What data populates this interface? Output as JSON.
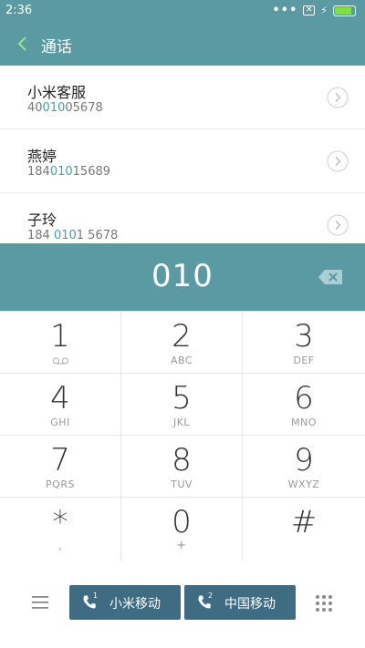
{
  "status_bar": {
    "time": "2:36",
    "dots": "•••",
    "sim_text": "✕",
    "battery_level": 0.85,
    "battery_color": "#7ee23a"
  },
  "app_bar": {
    "title": "通话",
    "color": "#5a9aa3"
  },
  "contacts": [
    {
      "name": "小米客服",
      "number_pre": "40",
      "number_match": "010",
      "number_post": "05678"
    },
    {
      "name": "燕婷",
      "number_pre": "184",
      "number_match": "010",
      "number_post": "15689"
    },
    {
      "name": "子玲",
      "number_pre": "184 ",
      "number_match": "010",
      "number_post": "1 5678"
    }
  ],
  "dialer": {
    "input": "010"
  },
  "keypad": [
    {
      "digit": "1",
      "letters": ""
    },
    {
      "digit": "2",
      "letters": "ABC"
    },
    {
      "digit": "3",
      "letters": "DEF"
    },
    {
      "digit": "4",
      "letters": "GHI"
    },
    {
      "digit": "5",
      "letters": "JKL"
    },
    {
      "digit": "6",
      "letters": "MNO"
    },
    {
      "digit": "7",
      "letters": "PQRS"
    },
    {
      "digit": "8",
      "letters": "TUV"
    },
    {
      "digit": "9",
      "letters": "WXYZ"
    },
    {
      "digit": "*",
      "letters": ","
    },
    {
      "digit": "0",
      "letters": "+"
    },
    {
      "digit": "#",
      "letters": ""
    }
  ],
  "bottom_bar": {
    "call_sim1": {
      "label": "小米移动",
      "sim": "1"
    },
    "call_sim2": {
      "label": "中国移动",
      "sim": "2"
    },
    "button_color": "#3f6c83"
  }
}
